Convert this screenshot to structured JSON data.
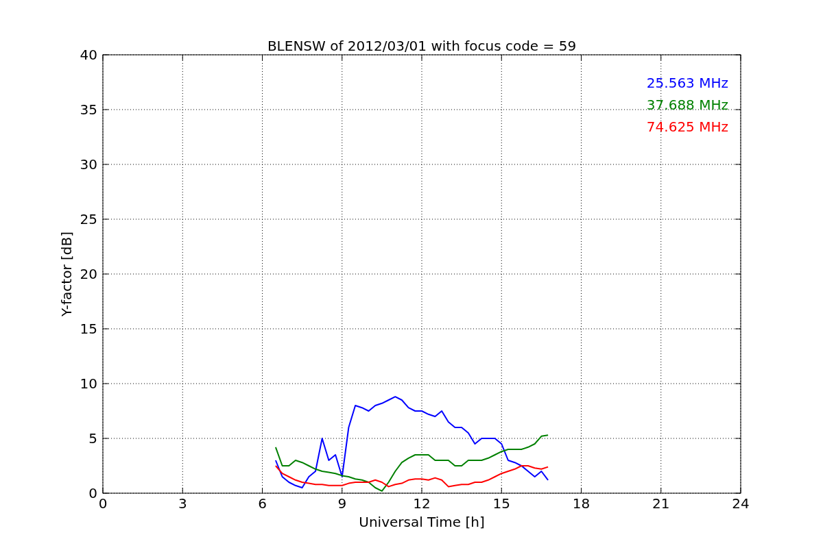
{
  "figure": {
    "chart_data": {
      "type": "line",
      "title": "BLENSW of 2012/03/01 with focus code = 59",
      "xlabel": "Universal Time [h]",
      "ylabel": "Y-factor [dB]",
      "x": [
        6.5,
        6.75,
        7,
        7.25,
        7.5,
        7.75,
        8,
        8.25,
        8.5,
        8.75,
        9,
        9.25,
        9.5,
        9.75,
        10,
        10.25,
        10.5,
        10.75,
        11,
        11.25,
        11.5,
        11.75,
        12,
        12.25,
        12.5,
        12.75,
        13,
        13.25,
        13.5,
        13.75,
        14,
        14.25,
        14.5,
        14.75,
        15,
        15.25,
        15.5,
        15.75,
        16,
        16.25,
        16.5,
        16.75
      ],
      "series": [
        {
          "name": "25.563 MHz",
          "color": "#0000ff",
          "values": [
            3,
            1.5,
            1,
            0.7,
            0.5,
            1.5,
            2,
            5,
            3,
            3.5,
            1.5,
            6,
            8,
            7.8,
            7.5,
            8,
            8.2,
            8.5,
            8.8,
            8.5,
            7.8,
            7.5,
            7.5,
            7.2,
            7,
            7.5,
            6.5,
            6,
            6,
            5.5,
            4.5,
            5,
            5,
            5,
            4.5,
            3,
            2.8,
            2.5,
            2,
            1.5,
            2,
            1.2
          ]
        },
        {
          "name": "37.688 MHz",
          "color": "#008000",
          "values": [
            4.2,
            2.5,
            2.5,
            3,
            2.8,
            2.5,
            2.2,
            2,
            1.9,
            1.8,
            1.6,
            1.5,
            1.3,
            1.2,
            1,
            0.5,
            0.2,
            1,
            2,
            2.8,
            3.2,
            3.5,
            3.5,
            3.5,
            3,
            3,
            3,
            2.5,
            2.5,
            3,
            3,
            3,
            3.2,
            3.5,
            3.8,
            4,
            4,
            4,
            4.2,
            4.5,
            5.2,
            5.3
          ]
        },
        {
          "name": "74.625 MHz",
          "color": "#ff0000",
          "values": [
            2.5,
            1.8,
            1.5,
            1.2,
            1,
            0.9,
            0.8,
            0.8,
            0.7,
            0.7,
            0.7,
            0.9,
            1,
            1,
            1,
            1.2,
            1,
            0.6,
            0.8,
            0.9,
            1.2,
            1.3,
            1.3,
            1.2,
            1.4,
            1.2,
            0.6,
            0.7,
            0.8,
            0.8,
            1,
            1,
            1.2,
            1.5,
            1.8,
            2,
            2.2,
            2.5,
            2.5,
            2.3,
            2.2,
            2.4
          ]
        }
      ],
      "xlim": [
        0,
        24
      ],
      "ylim": [
        0,
        40
      ],
      "xticks": [
        0,
        3,
        6,
        9,
        12,
        15,
        18,
        21,
        24
      ],
      "yticks": [
        0,
        5,
        10,
        15,
        20,
        25,
        30,
        35,
        40
      ],
      "grid": true
    }
  }
}
